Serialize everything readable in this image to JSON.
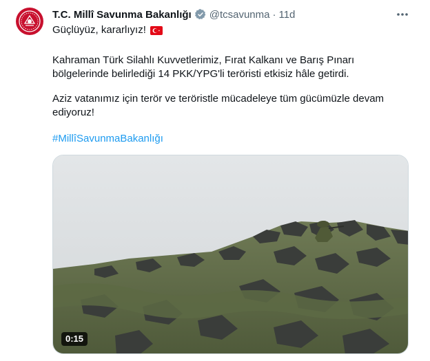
{
  "tweet": {
    "author_name": "T.C. Millî Savunma Bakanlığı",
    "handle": "@tcsavunma",
    "separator": "·",
    "time": "11d",
    "line1": "Güçlüyüz, kararlıyız!",
    "paragraph1_line1": "Kahraman Türk Silahlı Kuvvetlerimiz, Fırat Kalkanı ve Barış Pınarı",
    "paragraph1_line2": "bölgelerinde belirlediği 14 PKK/YPG'li teröristi etkisiz hâle getirdi.",
    "paragraph2_line1": "Aziz vatanımız için terör ve teröristle mücadeleye tüm gücümüzle devam",
    "paragraph2_line2": "ediyoruz!",
    "hashtag": "#MillîSavunmaBakanlığı"
  },
  "video": {
    "duration": "0:15"
  },
  "icons": {
    "verified": "verified-badge-icon",
    "more": "more-options-icon",
    "flag": "turkey-flag-emoji"
  },
  "colors": {
    "link": "#1d9bf0",
    "secondary_text": "#536471",
    "avatar_red": "#c8102e"
  }
}
